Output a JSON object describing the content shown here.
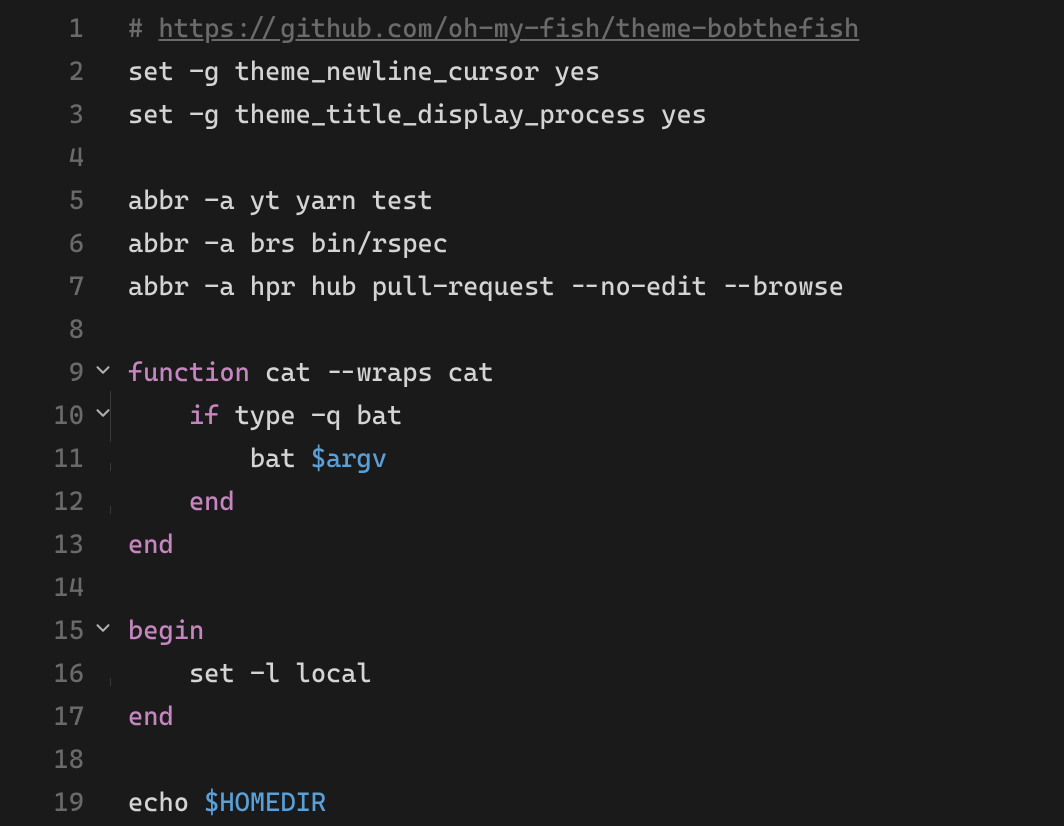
{
  "lines": [
    {
      "num": "1",
      "fold": "",
      "indentGuide": false,
      "tokens": [
        {
          "cls": "tok-comment",
          "t": "# "
        },
        {
          "cls": "tok-url",
          "t": "https://github.com/oh-my-fish/theme-bobthefish"
        }
      ]
    },
    {
      "num": "2",
      "fold": "",
      "indentGuide": false,
      "tokens": [
        {
          "cls": "tok-builtin",
          "t": "set"
        },
        {
          "cls": "tok-text",
          "t": " -g theme_newline_cursor yes"
        }
      ]
    },
    {
      "num": "3",
      "fold": "",
      "indentGuide": false,
      "tokens": [
        {
          "cls": "tok-builtin",
          "t": "set"
        },
        {
          "cls": "tok-text",
          "t": " -g theme_title_display_process yes"
        }
      ]
    },
    {
      "num": "4",
      "fold": "",
      "indentGuide": false,
      "tokens": []
    },
    {
      "num": "5",
      "fold": "",
      "indentGuide": false,
      "tokens": [
        {
          "cls": "tok-builtin",
          "t": "abbr"
        },
        {
          "cls": "tok-text",
          "t": " -a yt yarn test"
        }
      ]
    },
    {
      "num": "6",
      "fold": "",
      "indentGuide": false,
      "tokens": [
        {
          "cls": "tok-builtin",
          "t": "abbr"
        },
        {
          "cls": "tok-text",
          "t": " -a brs bin/rspec"
        }
      ]
    },
    {
      "num": "7",
      "fold": "",
      "indentGuide": false,
      "tokens": [
        {
          "cls": "tok-builtin",
          "t": "abbr"
        },
        {
          "cls": "tok-text",
          "t": " -a hpr hub pull-request --no-edit --browse"
        }
      ]
    },
    {
      "num": "8",
      "fold": "",
      "indentGuide": false,
      "tokens": []
    },
    {
      "num": "9",
      "fold": "open",
      "indentGuide": false,
      "tokens": [
        {
          "cls": "tok-keyword",
          "t": "function"
        },
        {
          "cls": "tok-text",
          "t": " cat --wraps cat"
        }
      ]
    },
    {
      "num": "10",
      "fold": "open",
      "indentGuide": true,
      "indent": 1,
      "tokens": [
        {
          "cls": "tok-keyword",
          "t": "if"
        },
        {
          "cls": "tok-text",
          "t": " type -q bat"
        }
      ]
    },
    {
      "num": "11",
      "fold": "",
      "indentGuide": true,
      "indent": 2,
      "tokens": [
        {
          "cls": "tok-text",
          "t": "bat "
        },
        {
          "cls": "tok-var",
          "t": "$argv"
        }
      ]
    },
    {
      "num": "12",
      "fold": "",
      "indentGuide": true,
      "indent": 1,
      "tokens": [
        {
          "cls": "tok-keyword",
          "t": "end"
        }
      ]
    },
    {
      "num": "13",
      "fold": "",
      "indentGuide": false,
      "tokens": [
        {
          "cls": "tok-keyword",
          "t": "end"
        }
      ]
    },
    {
      "num": "14",
      "fold": "",
      "indentGuide": false,
      "tokens": []
    },
    {
      "num": "15",
      "fold": "open",
      "indentGuide": false,
      "tokens": [
        {
          "cls": "tok-keyword",
          "t": "begin"
        }
      ]
    },
    {
      "num": "16",
      "fold": "",
      "indentGuide": true,
      "indent": 1,
      "tokens": [
        {
          "cls": "tok-builtin",
          "t": "set"
        },
        {
          "cls": "tok-text",
          "t": " -l local"
        }
      ]
    },
    {
      "num": "17",
      "fold": "",
      "indentGuide": false,
      "tokens": [
        {
          "cls": "tok-keyword",
          "t": "end"
        }
      ]
    },
    {
      "num": "18",
      "fold": "",
      "indentGuide": false,
      "tokens": []
    },
    {
      "num": "19",
      "fold": "",
      "indentGuide": false,
      "tokens": [
        {
          "cls": "tok-builtin",
          "t": "echo"
        },
        {
          "cls": "tok-text",
          "t": " "
        },
        {
          "cls": "tok-var",
          "t": "$HOMEDIR"
        }
      ]
    }
  ],
  "indentString": "    "
}
